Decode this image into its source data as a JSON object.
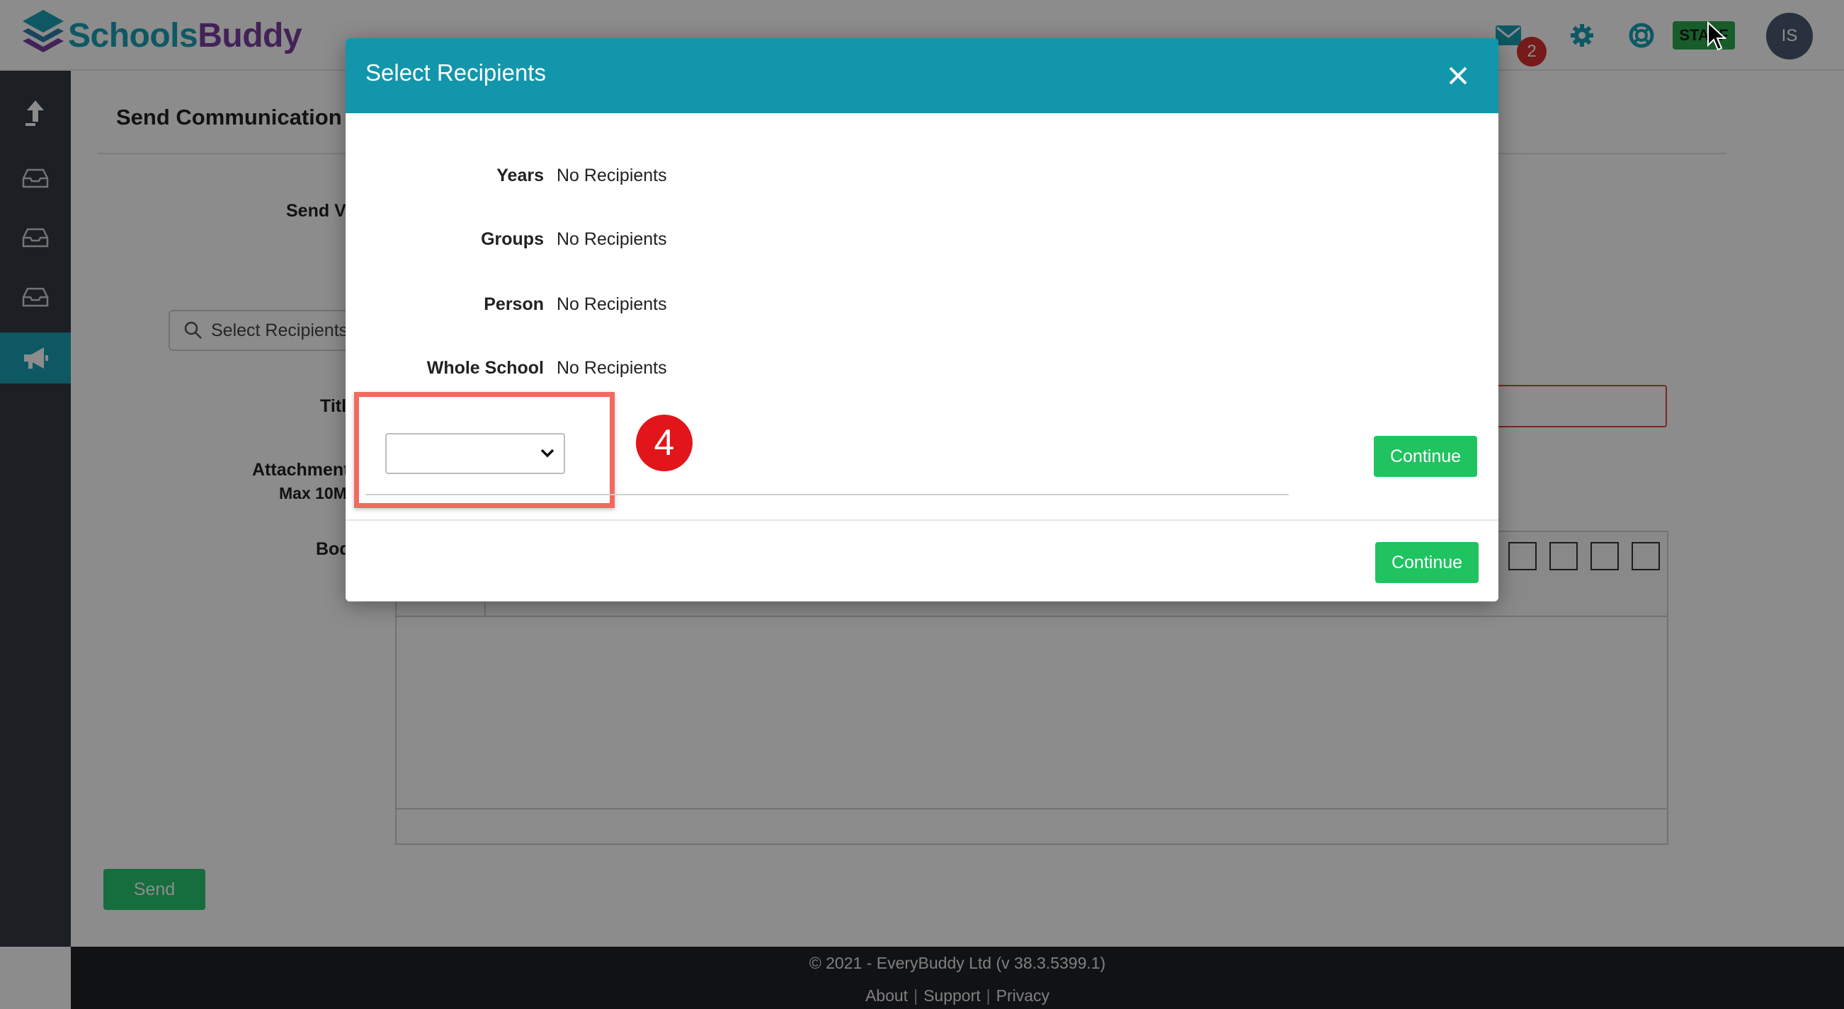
{
  "app": {
    "logo_part1": "Schools",
    "logo_part2": "Buddy",
    "mail_count": "2",
    "role_badge": "STAFF",
    "avatar_initials": "IS"
  },
  "page": {
    "title": "Send Communication",
    "send_via_label": "Send Vi",
    "select_recipients_label": "Select Recipients",
    "title_label": "Titl",
    "attachments_label": "Attachment",
    "attachments_sub": "Max 10M",
    "body_label": "Bod",
    "send_label": "Send"
  },
  "modal": {
    "title": "Select Recipients",
    "rows": [
      {
        "label": "Years",
        "value": "No Recipients"
      },
      {
        "label": "Groups",
        "value": "No Recipients"
      },
      {
        "label": "Person",
        "value": "No Recipients"
      },
      {
        "label": "Whole School",
        "value": "No Recipients"
      }
    ],
    "year_select_value": "",
    "step_number": "4",
    "continue_inner_label": "Continue",
    "continue_footer_label": "Continue"
  },
  "footer": {
    "copyright": "© 2021 - EveryBuddy Ltd (v 38.3.5399.1)",
    "links": [
      "About",
      "Support",
      "Privacy"
    ]
  },
  "colors": {
    "brand_teal": "#1296ab",
    "brand_purple": "#7b3fa0",
    "continue_green": "#1fc35f",
    "highlight_red": "#f06a5e",
    "step_red": "#e2151b"
  }
}
